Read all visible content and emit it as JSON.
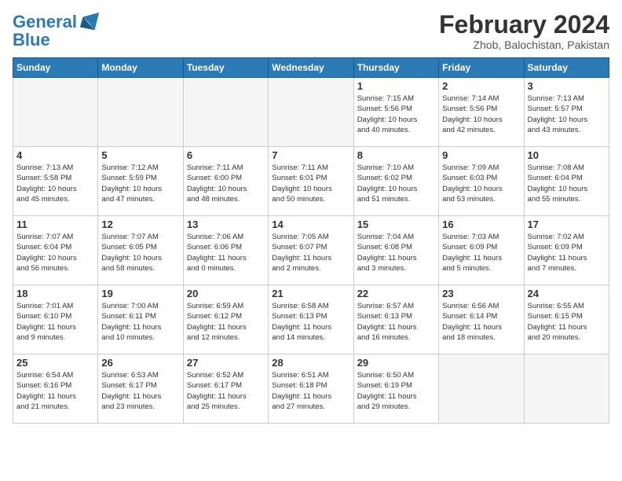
{
  "logo": {
    "line1": "General",
    "line2": "Blue"
  },
  "title": "February 2024",
  "subtitle": "Zhob, Balochistan, Pakistan",
  "weekdays": [
    "Sunday",
    "Monday",
    "Tuesday",
    "Wednesday",
    "Thursday",
    "Friday",
    "Saturday"
  ],
  "weeks": [
    [
      {
        "day": "",
        "info": ""
      },
      {
        "day": "",
        "info": ""
      },
      {
        "day": "",
        "info": ""
      },
      {
        "day": "",
        "info": ""
      },
      {
        "day": "1",
        "info": "Sunrise: 7:15 AM\nSunset: 5:56 PM\nDaylight: 10 hours\nand 40 minutes."
      },
      {
        "day": "2",
        "info": "Sunrise: 7:14 AM\nSunset: 5:56 PM\nDaylight: 10 hours\nand 42 minutes."
      },
      {
        "day": "3",
        "info": "Sunrise: 7:13 AM\nSunset: 5:57 PM\nDaylight: 10 hours\nand 43 minutes."
      }
    ],
    [
      {
        "day": "4",
        "info": "Sunrise: 7:13 AM\nSunset: 5:58 PM\nDaylight: 10 hours\nand 45 minutes."
      },
      {
        "day": "5",
        "info": "Sunrise: 7:12 AM\nSunset: 5:59 PM\nDaylight: 10 hours\nand 47 minutes."
      },
      {
        "day": "6",
        "info": "Sunrise: 7:11 AM\nSunset: 6:00 PM\nDaylight: 10 hours\nand 48 minutes."
      },
      {
        "day": "7",
        "info": "Sunrise: 7:11 AM\nSunset: 6:01 PM\nDaylight: 10 hours\nand 50 minutes."
      },
      {
        "day": "8",
        "info": "Sunrise: 7:10 AM\nSunset: 6:02 PM\nDaylight: 10 hours\nand 51 minutes."
      },
      {
        "day": "9",
        "info": "Sunrise: 7:09 AM\nSunset: 6:03 PM\nDaylight: 10 hours\nand 53 minutes."
      },
      {
        "day": "10",
        "info": "Sunrise: 7:08 AM\nSunset: 6:04 PM\nDaylight: 10 hours\nand 55 minutes."
      }
    ],
    [
      {
        "day": "11",
        "info": "Sunrise: 7:07 AM\nSunset: 6:04 PM\nDaylight: 10 hours\nand 56 minutes."
      },
      {
        "day": "12",
        "info": "Sunrise: 7:07 AM\nSunset: 6:05 PM\nDaylight: 10 hours\nand 58 minutes."
      },
      {
        "day": "13",
        "info": "Sunrise: 7:06 AM\nSunset: 6:06 PM\nDaylight: 11 hours\nand 0 minutes."
      },
      {
        "day": "14",
        "info": "Sunrise: 7:05 AM\nSunset: 6:07 PM\nDaylight: 11 hours\nand 2 minutes."
      },
      {
        "day": "15",
        "info": "Sunrise: 7:04 AM\nSunset: 6:08 PM\nDaylight: 11 hours\nand 3 minutes."
      },
      {
        "day": "16",
        "info": "Sunrise: 7:03 AM\nSunset: 6:09 PM\nDaylight: 11 hours\nand 5 minutes."
      },
      {
        "day": "17",
        "info": "Sunrise: 7:02 AM\nSunset: 6:09 PM\nDaylight: 11 hours\nand 7 minutes."
      }
    ],
    [
      {
        "day": "18",
        "info": "Sunrise: 7:01 AM\nSunset: 6:10 PM\nDaylight: 11 hours\nand 9 minutes."
      },
      {
        "day": "19",
        "info": "Sunrise: 7:00 AM\nSunset: 6:11 PM\nDaylight: 11 hours\nand 10 minutes."
      },
      {
        "day": "20",
        "info": "Sunrise: 6:59 AM\nSunset: 6:12 PM\nDaylight: 11 hours\nand 12 minutes."
      },
      {
        "day": "21",
        "info": "Sunrise: 6:58 AM\nSunset: 6:13 PM\nDaylight: 11 hours\nand 14 minutes."
      },
      {
        "day": "22",
        "info": "Sunrise: 6:57 AM\nSunset: 6:13 PM\nDaylight: 11 hours\nand 16 minutes."
      },
      {
        "day": "23",
        "info": "Sunrise: 6:56 AM\nSunset: 6:14 PM\nDaylight: 11 hours\nand 18 minutes."
      },
      {
        "day": "24",
        "info": "Sunrise: 6:55 AM\nSunset: 6:15 PM\nDaylight: 11 hours\nand 20 minutes."
      }
    ],
    [
      {
        "day": "25",
        "info": "Sunrise: 6:54 AM\nSunset: 6:16 PM\nDaylight: 11 hours\nand 21 minutes."
      },
      {
        "day": "26",
        "info": "Sunrise: 6:53 AM\nSunset: 6:17 PM\nDaylight: 11 hours\nand 23 minutes."
      },
      {
        "day": "27",
        "info": "Sunrise: 6:52 AM\nSunset: 6:17 PM\nDaylight: 11 hours\nand 25 minutes."
      },
      {
        "day": "28",
        "info": "Sunrise: 6:51 AM\nSunset: 6:18 PM\nDaylight: 11 hours\nand 27 minutes."
      },
      {
        "day": "29",
        "info": "Sunrise: 6:50 AM\nSunset: 6:19 PM\nDaylight: 11 hours\nand 29 minutes."
      },
      {
        "day": "",
        "info": ""
      },
      {
        "day": "",
        "info": ""
      }
    ]
  ]
}
